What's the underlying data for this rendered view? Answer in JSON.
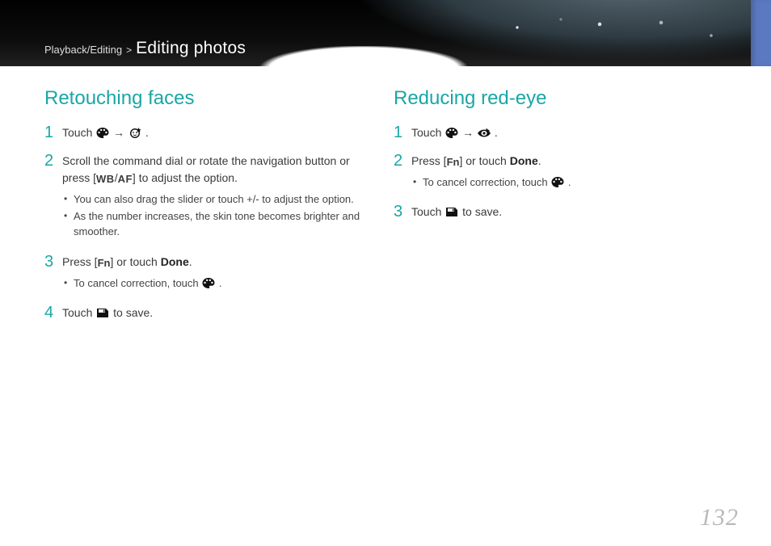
{
  "header": {
    "breadcrumb_parent": "Playback/Editing",
    "breadcrumb_sep": ">",
    "breadcrumb_title": "Editing photos"
  },
  "left": {
    "title": "Retouching faces",
    "s1": {
      "num": "1",
      "t1": "Touch ",
      "arrow": " → ",
      "t2": "."
    },
    "s2": {
      "num": "2",
      "t1": "Scroll the command dial or rotate the navigation button or press [",
      "wb": "WB",
      "slash": "/",
      "af": "AF",
      "t2": "] to adjust the option.",
      "b1": "You can also drag the slider or touch +/- to adjust the option.",
      "b2": "As the number increases, the skin tone becomes brighter and smoother."
    },
    "s3": {
      "num": "3",
      "t1": "Press [",
      "fn": "Fn",
      "t2": "] or touch ",
      "done": "Done",
      "t3": ".",
      "b1a": "To cancel correction, touch ",
      "b1b": "."
    },
    "s4": {
      "num": "4",
      "t1": "Touch ",
      "t2": " to save."
    }
  },
  "right": {
    "title": "Reducing red-eye",
    "s1": {
      "num": "1",
      "t1": "Touch ",
      "arrow": " → ",
      "t2": "."
    },
    "s2": {
      "num": "2",
      "t1": "Press [",
      "fn": "Fn",
      "t2": "] or touch ",
      "done": "Done",
      "t3": ".",
      "b1a": "To cancel correction, touch ",
      "b1b": "."
    },
    "s3": {
      "num": "3",
      "t1": "Touch ",
      "t2": " to save."
    }
  },
  "page_number": "132"
}
